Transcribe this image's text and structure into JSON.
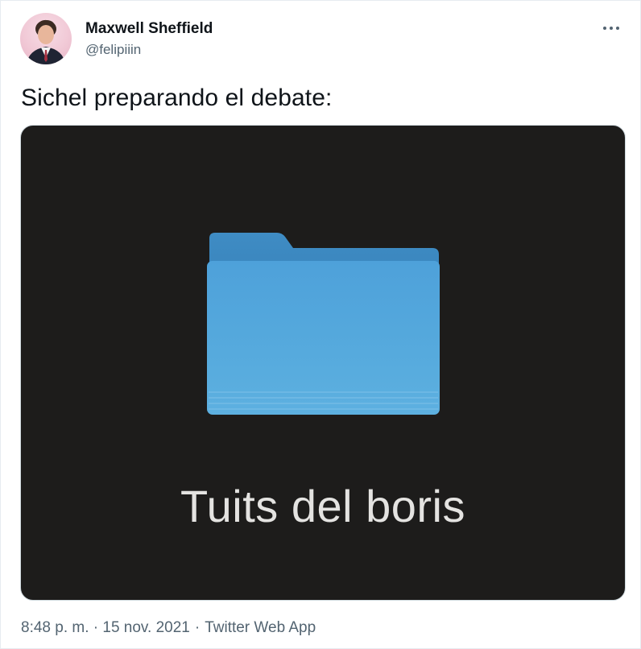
{
  "tweet": {
    "author": {
      "name": "Maxwell Sheffield",
      "handle": "@felipiiin"
    },
    "text": "Sichel preparando el debate:",
    "more_icon": "more-horizontal-icon",
    "media": {
      "folder_icon": "folder-icon",
      "caption": "Tuits del boris",
      "background_color": "#1d1c1b",
      "folder_color": "#4ba3dc"
    },
    "meta": {
      "time": "8:48 p. m.",
      "separator": "·",
      "date": "15 nov. 2021",
      "source": "Twitter Web App"
    }
  },
  "colors": {
    "text_primary": "#0f1419",
    "text_secondary": "#536471",
    "border": "#cfd9de"
  }
}
